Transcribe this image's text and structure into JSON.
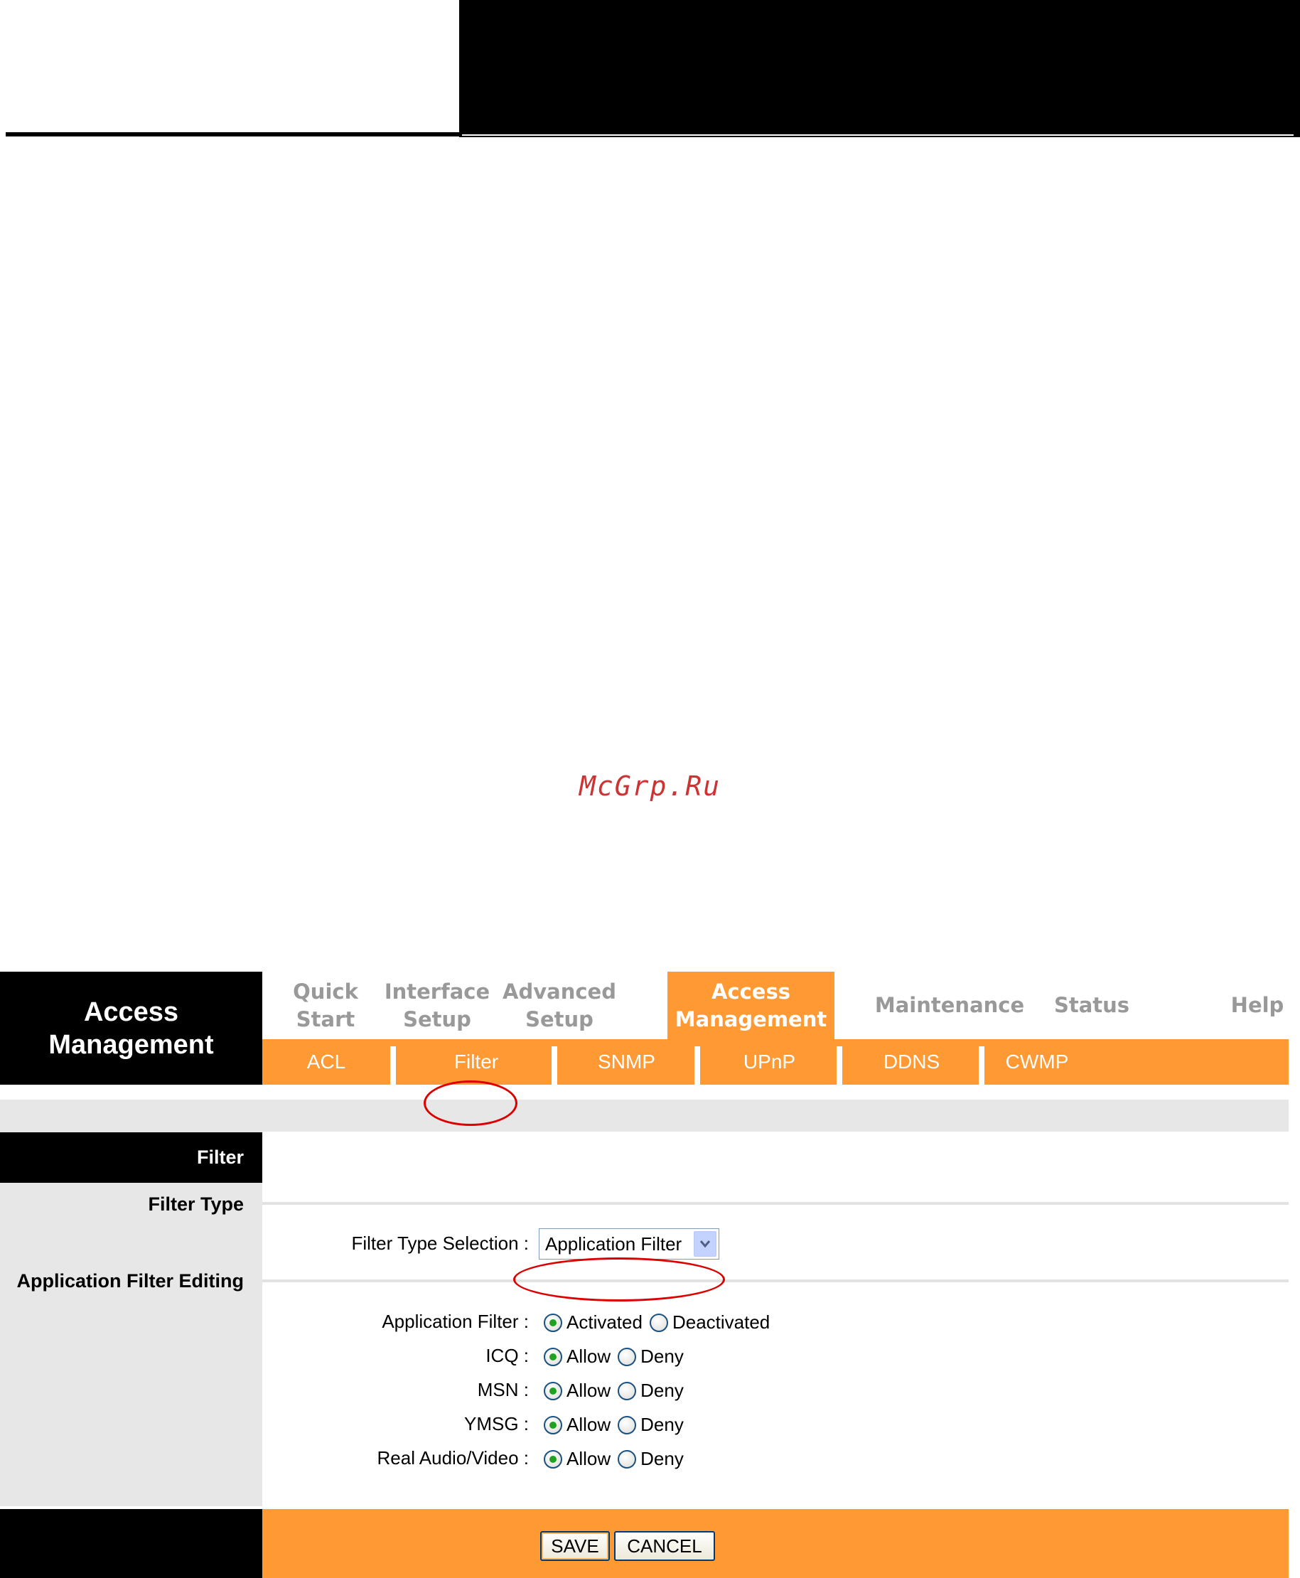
{
  "watermark": "McGrp.Ru",
  "brand": {
    "title": "Access\nManagement"
  },
  "nav": [
    {
      "label": "Quick\nStart",
      "active": false
    },
    {
      "label": "Interface\nSetup",
      "active": false
    },
    {
      "label": "Advanced\nSetup",
      "active": false
    },
    {
      "label": "Access\nManagement",
      "active": true
    },
    {
      "label": "Maintenance",
      "active": false
    },
    {
      "label": "Status",
      "active": false
    },
    {
      "label": "Help",
      "active": false
    }
  ],
  "subnav": [
    "ACL",
    "Filter",
    "SNMP",
    "UPnP",
    "DDNS",
    "CWMP"
  ],
  "section": {
    "header": "Filter",
    "filter_type_label": "Filter Type",
    "app_filter_editing_label": "Application Filter Editing"
  },
  "filter_type": {
    "label": "Filter Type Selection :",
    "selected": "Application Filter"
  },
  "app_filter": {
    "label": "Application Filter :",
    "options": [
      "Activated",
      "Deactivated"
    ],
    "selected": "Activated"
  },
  "rules": [
    {
      "label": "ICQ :",
      "options": [
        "Allow",
        "Deny"
      ],
      "selected": "Allow"
    },
    {
      "label": "MSN :",
      "options": [
        "Allow",
        "Deny"
      ],
      "selected": "Allow"
    },
    {
      "label": "YMSG :",
      "options": [
        "Allow",
        "Deny"
      ],
      "selected": "Allow"
    },
    {
      "label": "Real Audio/Video :",
      "options": [
        "Allow",
        "Deny"
      ],
      "selected": "Allow"
    }
  ],
  "buttons": {
    "save": "SAVE",
    "cancel": "CANCEL"
  },
  "colors": {
    "accent": "#ff9933",
    "panel_gray": "#e7e7e7",
    "annotation": "#dd0000"
  }
}
